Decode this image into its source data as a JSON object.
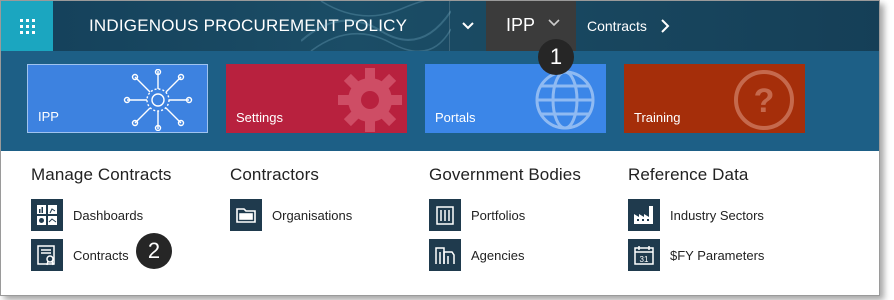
{
  "header": {
    "app_title": "INDIGENOUS PROCUREMENT POLICY",
    "app_button": "IPP",
    "breadcrumb": "Contracts"
  },
  "tiles": [
    {
      "label": "IPP",
      "color": "#3d82e0"
    },
    {
      "label": "Settings",
      "color": "#b8213e"
    },
    {
      "label": "Portals",
      "color": "#3b86e8"
    },
    {
      "label": "Training",
      "color": "#a52e0a"
    }
  ],
  "callouts": [
    "1",
    "2"
  ],
  "menu": {
    "manage_contracts": {
      "title": "Manage Contracts",
      "items": [
        {
          "label": "Dashboards",
          "icon": "dashboard-icon"
        },
        {
          "label": "Contracts",
          "icon": "certificate-icon"
        }
      ]
    },
    "contractors": {
      "title": "Contractors",
      "items": [
        {
          "label": "Organisations",
          "icon": "folder-icon"
        }
      ]
    },
    "government_bodies": {
      "title": "Government Bodies",
      "items": [
        {
          "label": "Portfolios",
          "icon": "building-icon"
        },
        {
          "label": "Agencies",
          "icon": "buildings-icon"
        }
      ]
    },
    "reference_data": {
      "title": "Reference Data",
      "items": [
        {
          "label": "Industry Sectors",
          "icon": "factory-icon"
        },
        {
          "label": "$FY Parameters",
          "icon": "calendar-icon"
        }
      ]
    }
  }
}
